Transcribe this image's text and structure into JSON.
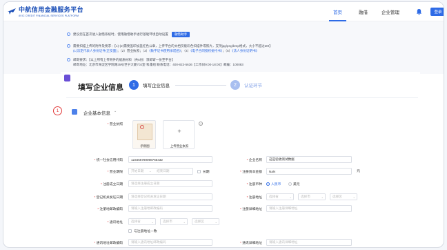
{
  "header": {
    "logo_cn": "中航信用金融服务平台",
    "logo_en": "AVIC CREDIT FINANCIAL SERVICES PLATFORM",
    "nav": {
      "home": "首页",
      "loan": "融借",
      "enterprise": "企业管理"
    },
    "login_label": "登录"
  },
  "notice": {
    "row1_text": "建议您在首次进入融借系统时，使用融借助手进行基础环境自动设置",
    "row1_button": "融借助手",
    "row2_line1": "需要扫描上传的附件及要求：【1)-(2)需要盖印加盖红色公章，上传平台的文档仅能彩色扫描件或照片，支持jpg/png/bmp格式，大小不超过2M】",
    "row2_line2_a": "(1)法定代表人身份证件(正反面)",
    "row2_line2_b": "；（2）营业执照；（3）",
    "row2_line2_c": "《数字证书使用承诺函》",
    "row2_line2_d": "；（4）",
    "row2_line2_e": "《电子合同授权委托书》",
    "row2_line2_f": "；（5）",
    "row2_line2_g": "《法人身份证明书》",
    "row3_line1": "邮寄要求：【以上所有上传附件的纸质材料（共5份）须邮寄一份至平台】",
    "row3_line2": "邮寄地址：北京市海淀区学院路35号世宁大厦702室·科蓬组 联系电话：400-823-5636【工作日9:00-18:00】邮编：100083"
  },
  "page": {
    "title": "填写企业信息",
    "step1_num": "1",
    "step1_label": "填写企业信息",
    "step2_num": "2",
    "step2_label": "认证环节",
    "annot_num": "1",
    "section_title": "企业基本信息",
    "section_chevron": "⌄"
  },
  "form": {
    "license_label": "营业执照",
    "sample_caption": "示例图",
    "upload_caption": "上传营业执照",
    "help_q": "?",
    "credit_code_label": "统一社会信用代码",
    "credit_code_value": "12345678909876543​2",
    "ent_name_label": "企业名称",
    "ent_name_value": "这是验收测试数据",
    "term_label": "营业期限",
    "term_start_ph": "开始日期",
    "term_sep": "~",
    "term_end_ph": "结束日期",
    "long_term_label": "长期",
    "reg_capital_label": "注册资本金额",
    "reg_capital_value": "NaN",
    "reg_capital_unit": "元",
    "reg_date_label": "注册成立日期",
    "reg_date_ph": "请选择注册成立日期",
    "currency_label": "注册币种",
    "currency_rmb": "人民币",
    "currency_usd": "美元",
    "issue_date_label": "登记机关发证日期",
    "issue_date_ph": "请选择登记机关发证日期",
    "reg_addr_label": "注册地址",
    "province_ph": "选择省",
    "city_ph": "选择市",
    "district_ph": "选择区",
    "reg_postcode_label": "注册地邮政编码",
    "reg_postcode_ph": "请输入注册地邮政编码",
    "reg_detail_label": "注册详细地址",
    "reg_detail_ph": "请输入注册详细地址",
    "comm_addr_label": "通讯地址",
    "same_as_reg_label": "与注册地址一致",
    "comm_postcode_label": "通讯地址邮政编码",
    "comm_postcode_ph": "请输入通讯地址邮政编码",
    "comm_detail_label": "通讯详细地址",
    "comm_detail_ph": "请输入通讯详细地址"
  },
  "colors": {
    "primary": "#2e6be6",
    "danger": "#e23b3b",
    "step_marker": "#6a4fd6"
  }
}
